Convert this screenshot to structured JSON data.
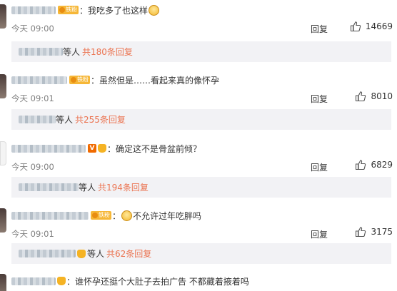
{
  "comments": [
    {
      "text": "我吃多了也这样",
      "time": "今天 09:00",
      "reply_label": "回复",
      "likes": "14669",
      "badge": "铁粉",
      "sub_etc": "等人",
      "sub_more": "共180条回复"
    },
    {
      "text": "虽然但是……看起来真的像怀孕",
      "time": "今天 09:01",
      "reply_label": "回复",
      "likes": "8010",
      "badge": "铁粉",
      "sub_etc": "等人",
      "sub_more": "共255条回复"
    },
    {
      "text": "确定这不是骨盆前倾？",
      "time": "今天 09:00",
      "reply_label": "回复",
      "likes": "6829",
      "sub_etc": "等人",
      "sub_more": "共194条回复"
    },
    {
      "text": "不允许过年吃胖吗",
      "time": "今天 09:01",
      "reply_label": "回复",
      "likes": "3175",
      "badge": "铁粉",
      "sub_etc": "等人",
      "sub_more": "共62条回复"
    },
    {
      "text": "谁怀孕还挺个大肚子去拍广告 不都藏着掖着吗"
    }
  ],
  "colors": {
    "link": "#eb7350",
    "meta": "#808080",
    "subbg": "#f2f2f5"
  }
}
